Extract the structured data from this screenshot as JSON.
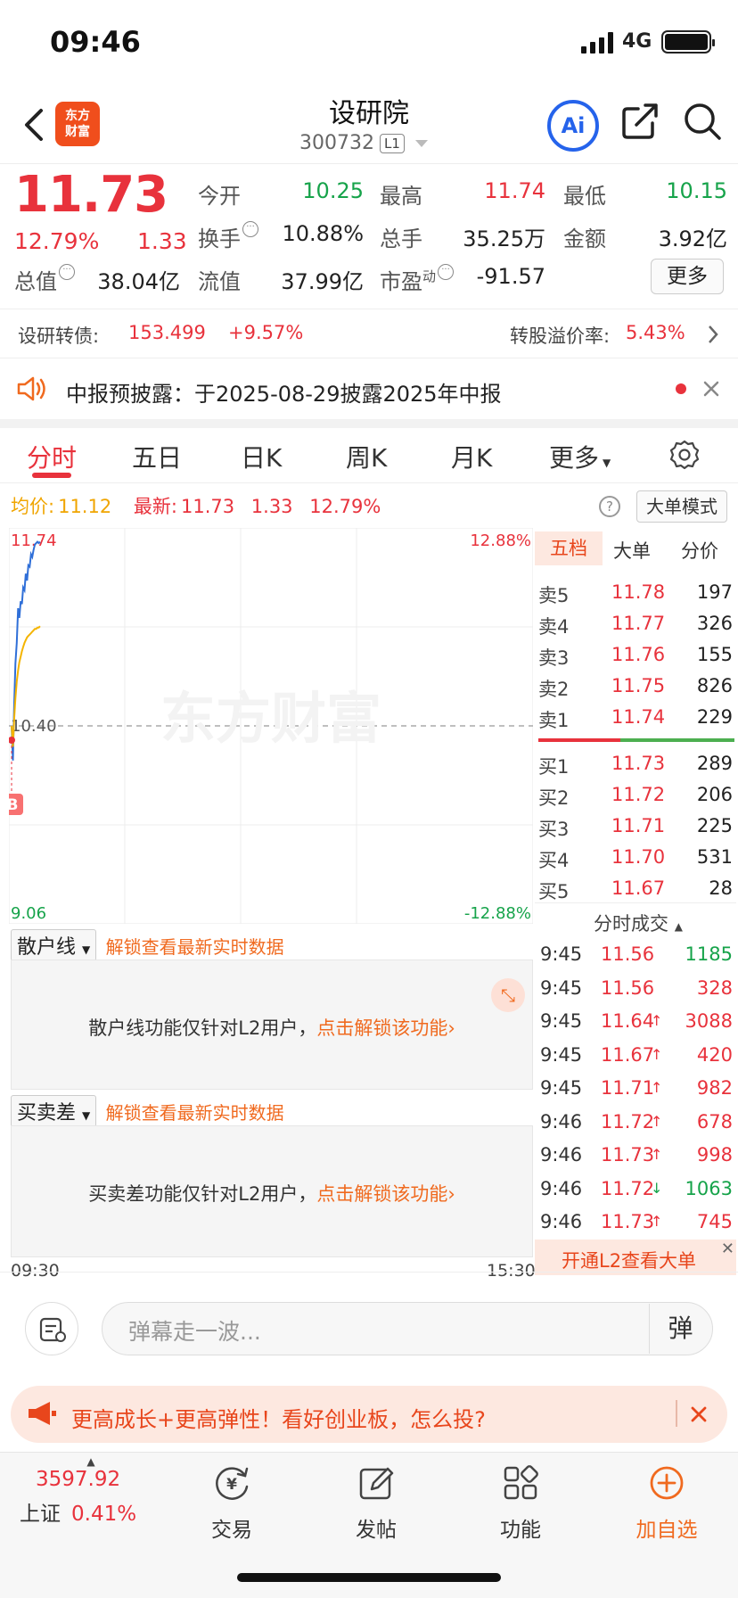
{
  "status_bar": {
    "time": "09:46",
    "network": "4G"
  },
  "header": {
    "logo_line1": "东方",
    "logo_line2": "财富",
    "name": "设研院",
    "code": "300732",
    "level_badge": "L1",
    "ai_label": "Ai"
  },
  "quote": {
    "price": "11.73",
    "change_pct": "12.79%",
    "change": "1.33",
    "fields": [
      {
        "label": "今开",
        "value": "10.25",
        "color": "green"
      },
      {
        "label": "最高",
        "value": "11.74",
        "color": "red"
      },
      {
        "label": "最低",
        "value": "10.15",
        "color": "green"
      },
      {
        "label": "换手",
        "value": "10.88%",
        "color": "dark"
      },
      {
        "label": "总手",
        "value": "35.25万",
        "color": "dark"
      },
      {
        "label": "金额",
        "value": "3.92亿",
        "color": "dark"
      },
      {
        "label": "总值",
        "value": "38.04亿",
        "color": "dark"
      },
      {
        "label": "流值",
        "value": "37.99亿",
        "color": "dark"
      },
      {
        "label": "市盈",
        "label_sup": "动",
        "value": "-91.57",
        "color": "dark"
      }
    ],
    "more_button": "更多"
  },
  "convertible": {
    "label": "设研转债:",
    "price": "153.499",
    "change": "+9.57%",
    "premium_label": "转股溢价率:",
    "premium": "5.43%"
  },
  "notice": {
    "text": "中报预披露：于2025-08-29披露2025年中报"
  },
  "tabs": [
    "分时",
    "五日",
    "日K",
    "周K",
    "月K",
    "更多"
  ],
  "active_tab": "分时",
  "intraday": {
    "avg_label": "均价:",
    "avg_value": "11.12",
    "latest_label": "最新:",
    "latest_value": "11.73",
    "latest_change": "1.33",
    "latest_pct": "12.79%",
    "big_order_button": "大单模式",
    "watermark": "东方财富",
    "b_marker": "B"
  },
  "chart_data": {
    "type": "line",
    "x_start": "09:30",
    "x_end": "15:30",
    "y_max_label": "11.74",
    "y_min_label": "9.06",
    "pct_max_label": "12.88%",
    "pct_min_label": "-12.88%",
    "prev_close": "10.40",
    "ylim": [
      9.06,
      11.74
    ],
    "series": [
      {
        "values": [
          10.4,
          10.15,
          10.55,
          10.85,
          11.0,
          11.25,
          11.18,
          11.3,
          11.28,
          11.4,
          11.38,
          11.5,
          11.45,
          11.56,
          11.55,
          11.64,
          11.62,
          11.67,
          11.71,
          11.72,
          11.73,
          11.72,
          11.73
        ],
        "color": "#2f6fd8"
      },
      {
        "values": [
          10.4,
          10.25,
          10.45,
          10.6,
          10.72,
          10.8,
          10.86,
          10.9,
          10.94,
          10.97,
          11.0,
          11.02,
          11.04,
          11.05,
          11.06,
          11.07,
          11.08,
          11.09,
          11.1,
          11.1,
          11.11,
          11.11,
          11.12
        ],
        "color": "#f4b400"
      }
    ]
  },
  "indicators": [
    {
      "select": "散户线",
      "unlock_link": "解锁查看最新实时数据",
      "message": "散户线功能仅针对L2用户，",
      "action": "点击解锁该功能"
    },
    {
      "select": "买卖差",
      "unlock_link": "解锁查看最新实时数据",
      "message": "买卖差功能仅针对L2用户，",
      "action": "点击解锁该功能"
    }
  ],
  "orderbook": {
    "tabs": [
      "五档",
      "大单",
      "分价"
    ],
    "asks": [
      {
        "label": "卖5",
        "price": "11.78",
        "vol": "197"
      },
      {
        "label": "卖4",
        "price": "11.77",
        "vol": "326"
      },
      {
        "label": "卖3",
        "price": "11.76",
        "vol": "155"
      },
      {
        "label": "卖2",
        "price": "11.75",
        "vol": "826"
      },
      {
        "label": "卖1",
        "price": "11.74",
        "vol": "229"
      }
    ],
    "bids": [
      {
        "label": "买1",
        "price": "11.73",
        "vol": "289"
      },
      {
        "label": "买2",
        "price": "11.72",
        "vol": "206"
      },
      {
        "label": "买3",
        "price": "11.71",
        "vol": "225"
      },
      {
        "label": "买4",
        "price": "11.70",
        "vol": "531"
      },
      {
        "label": "买5",
        "price": "11.67",
        "vol": "28"
      }
    ],
    "ticks_header": "分时成交",
    "ticks": [
      {
        "time": "9:45",
        "price": "11.56",
        "arrow": "",
        "vol": "1185",
        "vol_color": "green"
      },
      {
        "time": "9:45",
        "price": "11.56",
        "arrow": "",
        "vol": "328",
        "vol_color": "red"
      },
      {
        "time": "9:45",
        "price": "11.64",
        "arrow": "↑",
        "vol": "3088",
        "vol_color": "red"
      },
      {
        "time": "9:45",
        "price": "11.67",
        "arrow": "↑",
        "vol": "420",
        "vol_color": "red"
      },
      {
        "time": "9:45",
        "price": "11.71",
        "arrow": "↑",
        "vol": "982",
        "vol_color": "red"
      },
      {
        "time": "9:46",
        "price": "11.72",
        "arrow": "↑",
        "vol": "678",
        "vol_color": "red"
      },
      {
        "time": "9:46",
        "price": "11.73",
        "arrow": "↑",
        "vol": "998",
        "vol_color": "red"
      },
      {
        "time": "9:46",
        "price": "11.72",
        "arrow": "↓",
        "vol": "1063",
        "vol_color": "green"
      },
      {
        "time": "9:46",
        "price": "11.73",
        "arrow": "↑",
        "vol": "745",
        "vol_color": "red"
      }
    ],
    "l2_promo": "开通L2查看大单"
  },
  "danmaku": {
    "placeholder": "弹幕走一波...",
    "send_label": "弹"
  },
  "banner": {
    "text": "更高成长+更高弹性！看好创业板，怎么投?"
  },
  "bottom_nav": {
    "index_value": "3597.92",
    "index_name": "上证",
    "index_pct": "0.41%",
    "items": [
      {
        "label": "交易",
        "icon": "yuan-cycle-icon"
      },
      {
        "label": "发帖",
        "icon": "edit-icon"
      },
      {
        "label": "功能",
        "icon": "grid-icon"
      },
      {
        "label": "加自选",
        "icon": "plus-circle-icon"
      }
    ]
  },
  "colors": {
    "up": "#e8323c",
    "down": "#16a34a",
    "accent": "#f06a1f"
  }
}
